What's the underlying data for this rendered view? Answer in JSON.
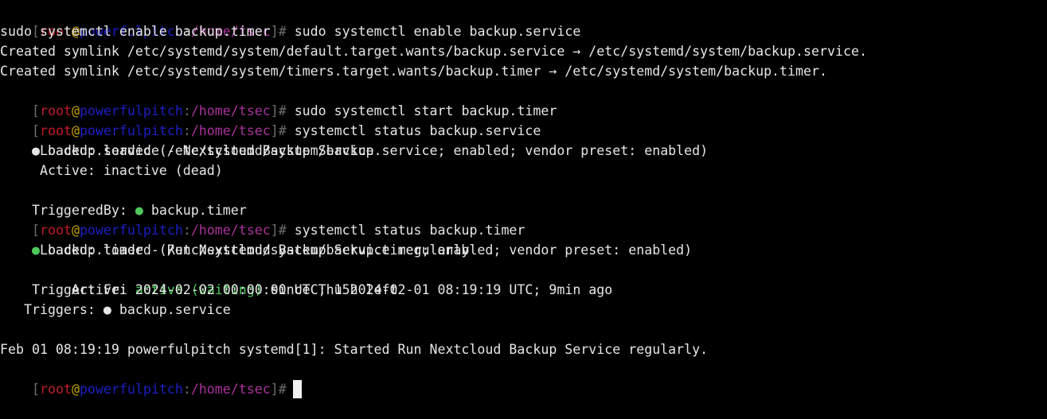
{
  "prompt": {
    "open_bracket": "[",
    "user": "root",
    "at": "@",
    "host": "powerfulpitch",
    "sep": ":",
    "path": "/home/tsec",
    "close": "]#"
  },
  "lines": {
    "l1_cmd": " sudo systemctl enable backup.service",
    "l2": "sudo systemctl enable backup.timer",
    "l3": "Created symlink /etc/systemd/system/default.target.wants/backup.service → /etc/systemd/system/backup.service.",
    "l4": "Created symlink /etc/systemd/system/timers.target.wants/backup.timer → /etc/systemd/system/backup.timer.",
    "l5_cmd": " sudo systemctl start backup.timer",
    "l6_cmd": " systemctl status backup.service",
    "l7_dot": "●",
    "l7_text": " backup.service - Nextcloud Backup Service",
    "l8": "     Loaded: loaded (/etc/systemd/system/backup.service; enabled; vendor preset: enabled)",
    "l9": "     Active: inactive (dead)",
    "l10_label": "TriggeredBy: ",
    "l10_dot": "●",
    "l10_text": " backup.timer",
    "l11_cmd": " systemctl status backup.timer",
    "l12_dot": "●",
    "l12_text": " backup.timer - Run Nextcloud Backup Service regularly",
    "l13": "     Loaded: loaded (/etc/systemd/system/backup.timer; enabled; vendor preset: enabled)",
    "l14_label": "     Active: ",
    "l14_status": "active (waiting)",
    "l14_rest": " since Thu 2024-02-01 08:19:19 UTC; 9min ago",
    "l15": "    Trigger: Fri 2024-02-02 00:00:00 UTC; 15h left",
    "l16": "   Triggers: ● backup.service",
    "l17": "",
    "l18": "Feb 01 08:19:19 powerfulpitch systemd[1]: Started Run Nextcloud Backup Service regularly.",
    "l19_cmd": " "
  },
  "colors": {
    "background": "#000000",
    "foreground": "#e6e6e6",
    "user": "#c01c28",
    "at": "#c4a000",
    "host": "#1c1fc4",
    "path": "#a8329b",
    "active_green": "#4ec85a"
  }
}
